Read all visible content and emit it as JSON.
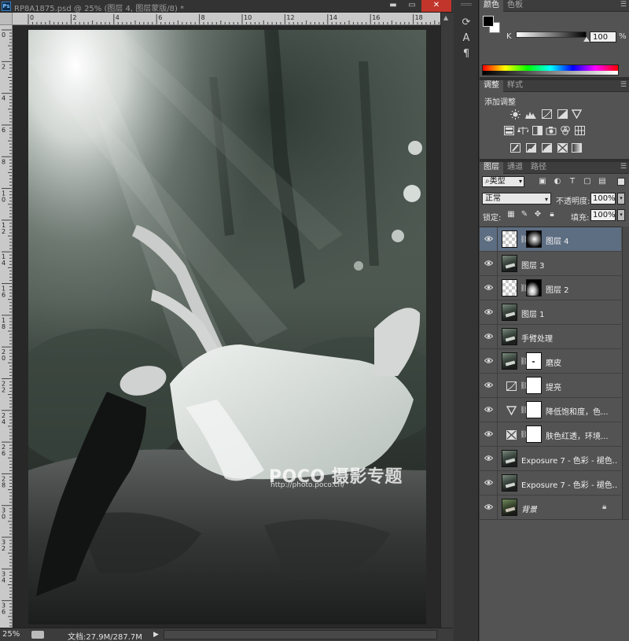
{
  "document": {
    "title": "RP8A1875.psd @ 25% (图层 4, 图层蒙版/8) *",
    "window_controls": {
      "minimize": "▬",
      "maximize": "▭",
      "close": "✕"
    },
    "ruler_top_labels": [
      "0",
      "2",
      "4",
      "6",
      "8",
      "10",
      "12",
      "14",
      "16",
      "18"
    ],
    "ruler_left_labels": [
      "0",
      "2",
      "4",
      "6",
      "8",
      "10",
      "12",
      "14",
      "16",
      "18",
      "20",
      "22",
      "24",
      "26",
      "28",
      "30",
      "32",
      "34",
      "36"
    ],
    "watermark_main": "POCO 摄影专题",
    "watermark_url": "http://photo.poco.cn/",
    "status": {
      "zoom": "25%",
      "doc_size": "文档:27.9M/287.7M",
      "arrow": "▶"
    }
  },
  "dock": {
    "tools": [
      "⟳",
      "A",
      "¶"
    ]
  },
  "color_panel": {
    "tabs": [
      "颜色",
      "色板"
    ],
    "channel_label": "K",
    "value": "100",
    "unit": "%",
    "foreground": "#000000",
    "background": "#ffffff"
  },
  "adjustments_panel": {
    "tabs": [
      "调整",
      "样式"
    ],
    "title": "添加调整"
  },
  "layers_panel": {
    "tabs": [
      "图层",
      "通道",
      "路径"
    ],
    "filter_kind": "类型",
    "blend_mode": "正常",
    "opacity_label": "不透明度:",
    "opacity_value": "100%",
    "lock_label": "锁定:",
    "fill_label": "填充:",
    "fill_value": "100%",
    "selected_color": "#5d6d82",
    "layers": [
      {
        "name": "图层 4",
        "selected": true
      },
      {
        "name": "图层 3",
        "selected": false
      },
      {
        "name": "图层 2",
        "selected": false
      },
      {
        "name": "图层 1",
        "selected": false
      },
      {
        "name": "手臂处理",
        "selected": false
      },
      {
        "name": "磨皮",
        "selected": false
      },
      {
        "name": "提亮",
        "selected": false
      },
      {
        "name": "降低饱和度，色...",
        "selected": false
      },
      {
        "name": "肤色红透，环境...",
        "selected": false
      },
      {
        "name": "Exposure 7 - 色彩 - 褪色...",
        "selected": false
      },
      {
        "name": "Exposure 7 - 色彩 - 褪色...",
        "selected": false
      },
      {
        "name": "背景",
        "selected": false
      }
    ]
  }
}
